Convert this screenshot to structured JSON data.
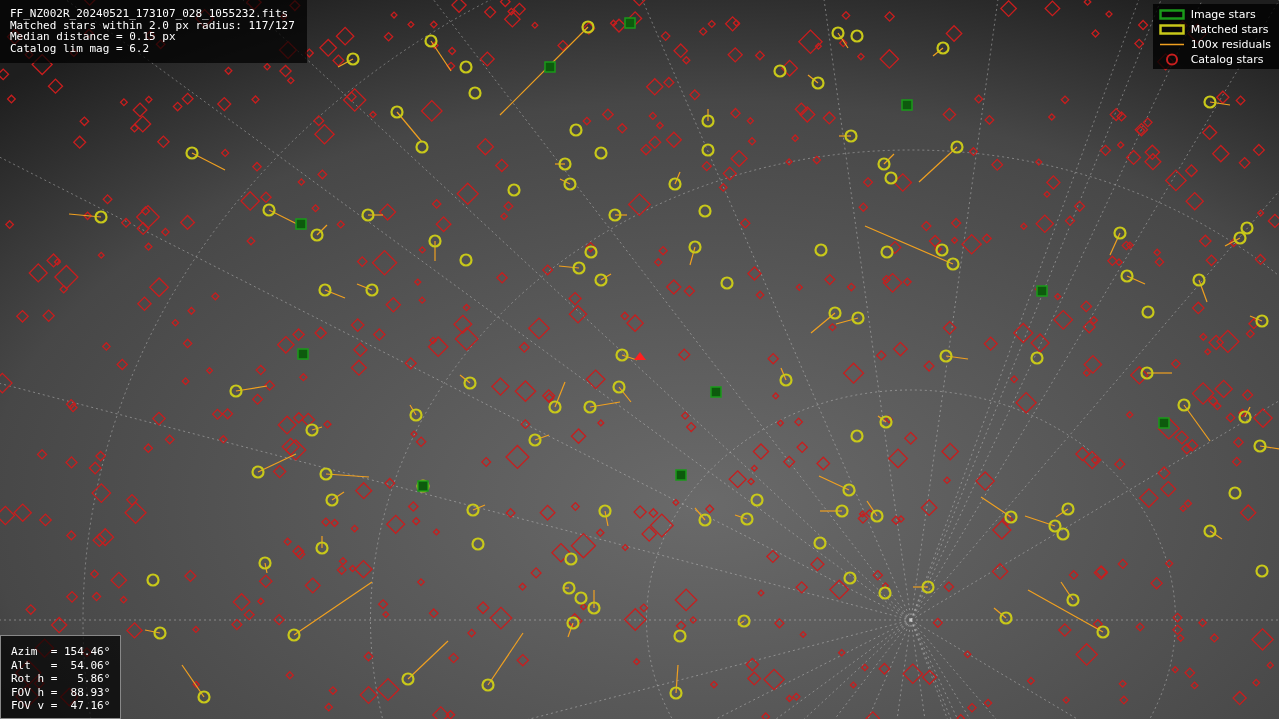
{
  "info": {
    "lines": [
      "FF_NZ002R_20240521_173107_028_1055232.fits",
      "Matched stars within 2.0 px radius: 117/127",
      "Median distance = 0.15 px",
      "Catalog lim mag = 6.2"
    ]
  },
  "legend": [
    {
      "kind": "image",
      "label": "Image stars",
      "color": "#1a9a1a"
    },
    {
      "kind": "matched",
      "label": "Matched stars",
      "color": "#c8c81a"
    },
    {
      "kind": "residual",
      "label": "100x residuals",
      "color": "#f0a020"
    },
    {
      "kind": "catalog",
      "label": "Catalog stars",
      "color": "#c81e1e"
    }
  ],
  "pointing": {
    "lines": [
      "Azim  = 154.46°",
      "Alt   =  54.06°",
      "Rot h =   5.86°",
      "FOV h =  88.93°",
      "FOV v =  47.16°"
    ]
  }
}
